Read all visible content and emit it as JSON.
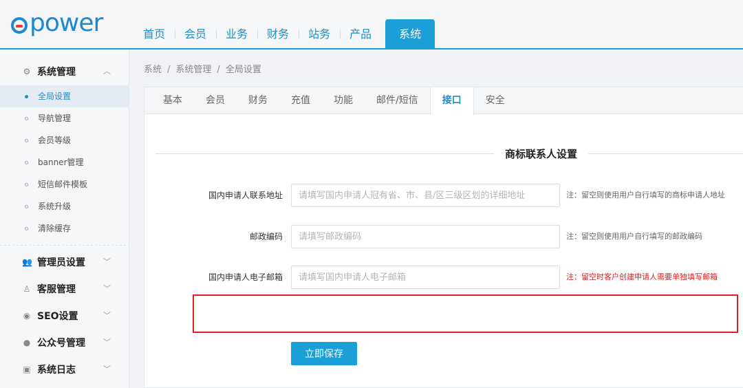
{
  "logo": {
    "text": "power"
  },
  "nav": {
    "items": [
      {
        "label": "首页"
      },
      {
        "label": "会员"
      },
      {
        "label": "业务"
      },
      {
        "label": "财务"
      },
      {
        "label": "站务"
      },
      {
        "label": "产品"
      },
      {
        "label": "系统",
        "active": true
      }
    ]
  },
  "sidebar": {
    "groups": [
      {
        "label": "系统管理",
        "icon": "gears-icon",
        "expanded": true,
        "items": [
          {
            "label": "全局设置",
            "active": true
          },
          {
            "label": "导航管理"
          },
          {
            "label": "会员等级"
          },
          {
            "label": "banner管理"
          },
          {
            "label": "短信邮件模板"
          },
          {
            "label": "系统升级"
          },
          {
            "label": "清除缓存"
          }
        ]
      },
      {
        "label": "管理员设置",
        "icon": "users-icon"
      },
      {
        "label": "客服管理",
        "icon": "service-icon"
      },
      {
        "label": "SEO设置",
        "icon": "globe-icon"
      },
      {
        "label": "公众号管理",
        "icon": "wechat-icon"
      },
      {
        "label": "系统日志",
        "icon": "log-icon"
      }
    ]
  },
  "breadcrumb": {
    "items": [
      "系统",
      "系统管理",
      "全局设置"
    ],
    "separator": "/"
  },
  "tabs": {
    "items": [
      {
        "label": "基本"
      },
      {
        "label": "会员"
      },
      {
        "label": "财务"
      },
      {
        "label": "充值"
      },
      {
        "label": "功能"
      },
      {
        "label": "邮件/短信"
      },
      {
        "label": "接口",
        "active": true
      },
      {
        "label": "安全"
      }
    ]
  },
  "section": {
    "title": "商标联系人设置"
  },
  "form": {
    "fields": [
      {
        "label": "国内申请人联系地址",
        "value": "",
        "placeholder": "请填写国内申请人冠有省、市、县/区三级区划的详细地址",
        "hint": "注：留空则使用用户自行填写的商标申请人地址"
      },
      {
        "label": "邮政编码",
        "value": "",
        "placeholder": "请填写邮政编码",
        "hint": "注：留空则使用用户自行填写的邮政编码"
      },
      {
        "label": "国内申请人电子邮箱",
        "value": "",
        "placeholder": "请填写国内申请人电子邮箱",
        "hint": "注：留空时客户创建申请人需要单独填写邮箱"
      }
    ],
    "save_label": "立即保存"
  },
  "colors": {
    "accent": "#1a9fd6",
    "warning": "#e02020",
    "logo_red": "#e53935"
  }
}
